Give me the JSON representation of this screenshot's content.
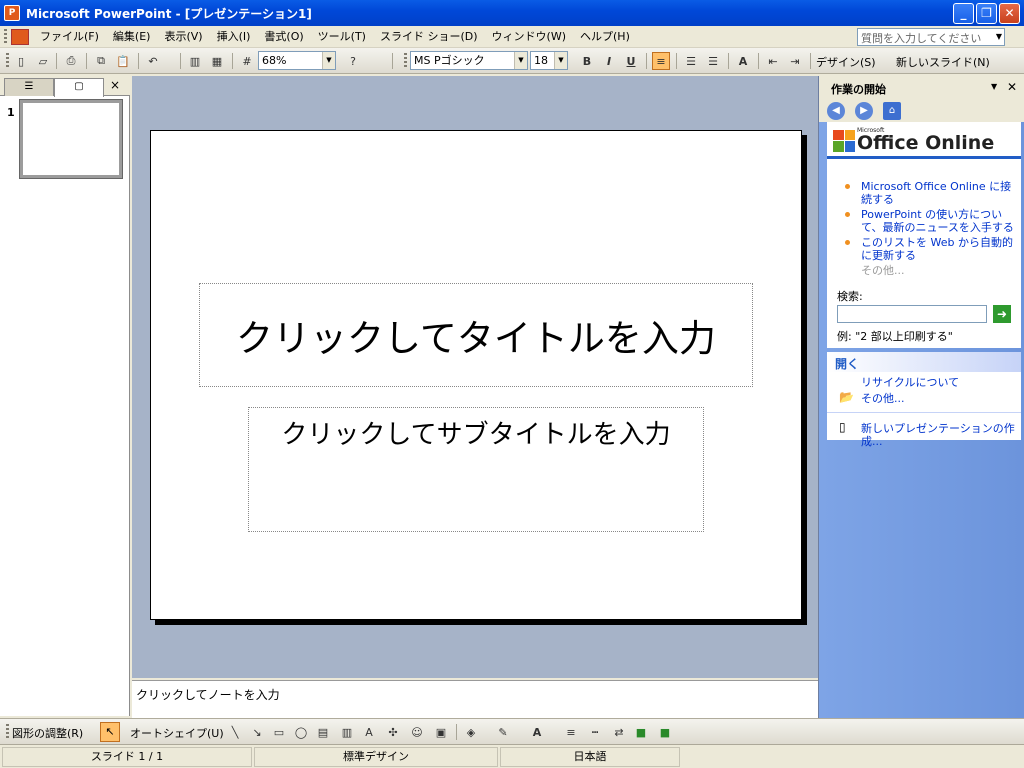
{
  "window": {
    "title": "Microsoft PowerPoint - [プレゼンテーション1]",
    "min_label": "_",
    "restore_label": "❐",
    "close_label": "✕"
  },
  "menubar": {
    "items": [
      "ファイル(F)",
      "編集(E)",
      "表示(V)",
      "挿入(I)",
      "書式(O)",
      "ツール(T)",
      "スライド ショー(D)",
      "ウィンドウ(W)",
      "ヘルプ(H)"
    ],
    "help_placeholder": "質問を入力してください"
  },
  "toolbar": {
    "zoom": "68%",
    "font": "MS Pゴシック",
    "size": "18",
    "bold": "B",
    "italic": "I",
    "underline": "U",
    "design_label": "デザイン(S)",
    "new_slide_label": "新しいスライド(N)"
  },
  "leftpane": {
    "slide_number": "1",
    "close_label": "×"
  },
  "slide": {
    "title_placeholder": "クリックしてタイトルを入力",
    "subtitle_placeholder": "クリックしてサブタイトルを入力"
  },
  "notes": {
    "placeholder": "クリックしてノートを入力"
  },
  "taskpane": {
    "title": "作業の開始",
    "logo_small": "Microsoft",
    "logo_text": "Office Online",
    "links": [
      "Microsoft Office Online に接続する",
      "PowerPoint の使い方について、最新のニュースを入手する",
      "このリストを Web から自動的に更新する"
    ],
    "more": "その他...",
    "search_label": "検索:",
    "search_example": "例: \"2 部以上印刷する\"",
    "open_section": "開く",
    "open_items": [
      "リサイクルについて",
      "その他..."
    ],
    "new_presentation": "新しいプレゼンテーションの作成..."
  },
  "drawtoolbar": {
    "draw_label": "図形の調整(R)",
    "autoshape_label": "オートシェイプ(U)"
  },
  "statusbar": {
    "slide": "スライド 1 / 1",
    "design": "標準デザイン",
    "language": "日本語"
  }
}
